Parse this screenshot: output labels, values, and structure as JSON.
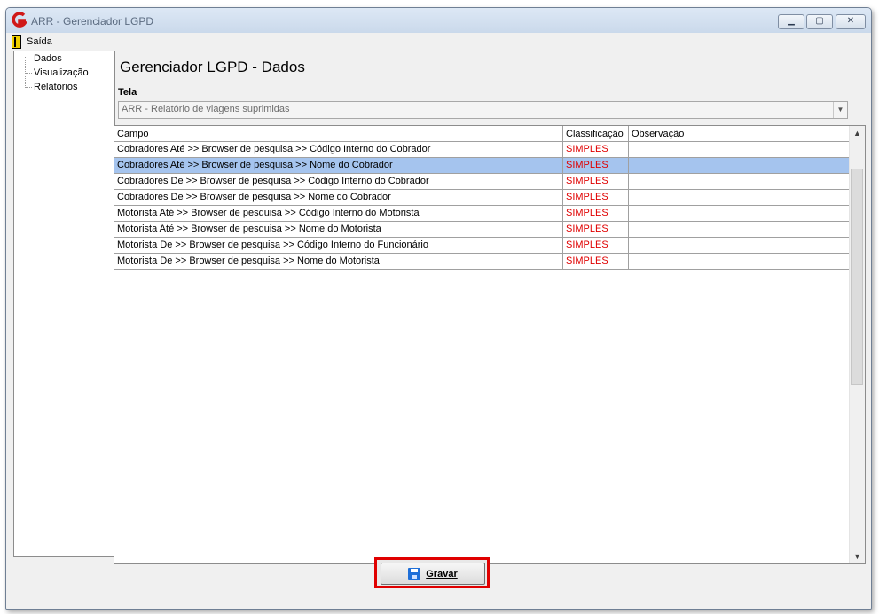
{
  "window": {
    "title": "ARR - Gerenciador LGPD",
    "minimize_icon": "minimize-icon",
    "maximize_icon": "maximize-icon",
    "close_icon": "close-icon"
  },
  "menu": {
    "exit_label": "Saída"
  },
  "tree": {
    "items": [
      "Dados",
      "Visualização",
      "Relatórios"
    ]
  },
  "page": {
    "title": "Gerenciador LGPD - Dados"
  },
  "screen_selector": {
    "label": "Tela",
    "value": "ARR - Relatório de viagens suprimidas"
  },
  "table": {
    "columns": [
      "Campo",
      "Classificação",
      "Observação"
    ],
    "rows": [
      {
        "campo": "Cobradores Até >> Browser de pesquisa >> Código Interno do Cobrador",
        "classificacao": "SIMPLES",
        "observacao": ""
      },
      {
        "campo": "Cobradores Até >> Browser de pesquisa >> Nome do Cobrador",
        "classificacao": "SIMPLES",
        "observacao": ""
      },
      {
        "campo": "Cobradores De >> Browser de pesquisa >> Código Interno do Cobrador",
        "classificacao": "SIMPLES",
        "observacao": ""
      },
      {
        "campo": "Cobradores De >> Browser de pesquisa >> Nome do Cobrador",
        "classificacao": "SIMPLES",
        "observacao": ""
      },
      {
        "campo": "Motorista Até >> Browser de pesquisa >> Código Interno do Motorista",
        "classificacao": "SIMPLES",
        "observacao": ""
      },
      {
        "campo": "Motorista Até >> Browser de pesquisa >> Nome do Motorista",
        "classificacao": "SIMPLES",
        "observacao": ""
      },
      {
        "campo": "Motorista De >> Browser de pesquisa >> Código Interno do Funcionário",
        "classificacao": "SIMPLES",
        "observacao": ""
      },
      {
        "campo": "Motorista De >> Browser de pesquisa >> Nome do Motorista",
        "classificacao": "SIMPLES",
        "observacao": ""
      }
    ]
  },
  "footer": {
    "save_label": "Gravar",
    "save_icon": "floppy-disk-icon"
  },
  "colors": {
    "classification": "#e00000",
    "selection": "#a5c4ee",
    "highlight_box": "#e00000"
  }
}
